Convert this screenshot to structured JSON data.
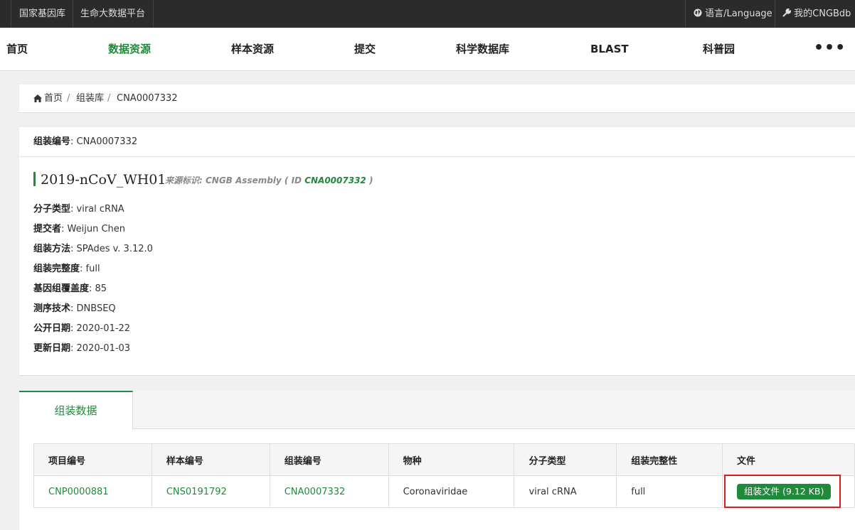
{
  "topbar": {
    "links": [
      "国家基因库",
      "生命大数据平台"
    ],
    "language": "语言/Language",
    "account": "我的CNGBdb"
  },
  "nav": {
    "items": [
      "首页",
      "数据资源",
      "样本资源",
      "提交",
      "科学数据库",
      "BLAST",
      "科普园"
    ],
    "active": "数据资源",
    "more": "•••"
  },
  "breadcrumb": {
    "home": "首页",
    "level1": "组装库",
    "current": "CNA0007332",
    "sep": "/"
  },
  "detail": {
    "id_label": "组装编号",
    "id_value": "CNA0007332",
    "title": "2019-nCoV_WH01",
    "source_prefix": "来源标识: CNGB Assembly ( ID ",
    "source_id": "CNA0007332",
    "source_suffix": " )",
    "fields": [
      {
        "label": "分子类型",
        "value": "viral cRNA"
      },
      {
        "label": "提交者",
        "value": "Weijun Chen"
      },
      {
        "label": "组装方法",
        "value": "SPAdes v. 3.12.0"
      },
      {
        "label": "组装完整度",
        "value": "full"
      },
      {
        "label": "基因组覆盖度",
        "value": "85"
      },
      {
        "label": "测序技术",
        "value": "DNBSEQ"
      },
      {
        "label": "公开日期",
        "value": "2020-01-22"
      },
      {
        "label": "更新日期",
        "value": "2020-01-03"
      }
    ]
  },
  "tab": {
    "label": "组装数据"
  },
  "table": {
    "headers": [
      "项目编号",
      "样本编号",
      "组装编号",
      "物种",
      "分子类型",
      "组装完整性",
      "文件"
    ],
    "row": {
      "project": "CNP0000881",
      "sample": "CNS0191792",
      "assembly": "CNA0007332",
      "species": "Coronaviridae",
      "molecule": "viral cRNA",
      "completeness": "full",
      "file_button": "组装文件 (9.12 KB)"
    }
  },
  "colors": {
    "accent": "#1f8a3a",
    "topbar": "#2b2b2b",
    "highlight": "#e01919"
  },
  "icons": {
    "language": "globe-icon",
    "account": "wrench-icon",
    "home": "home-icon"
  }
}
